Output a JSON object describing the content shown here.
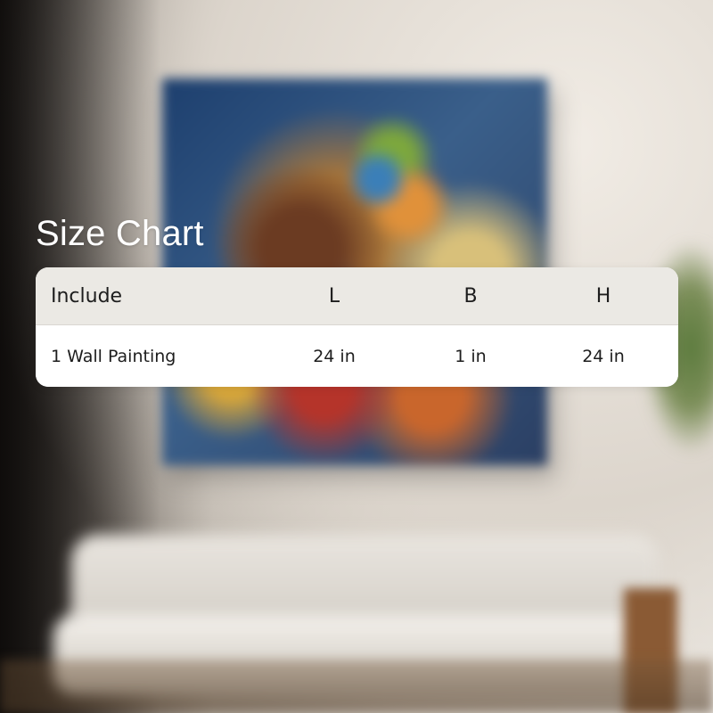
{
  "size_chart": {
    "title": "Size Chart",
    "columns": [
      "Include",
      "L",
      "B",
      "H"
    ],
    "rows": [
      [
        "1 Wall Painting",
        "24 in",
        "1 in",
        "24 in"
      ]
    ]
  }
}
